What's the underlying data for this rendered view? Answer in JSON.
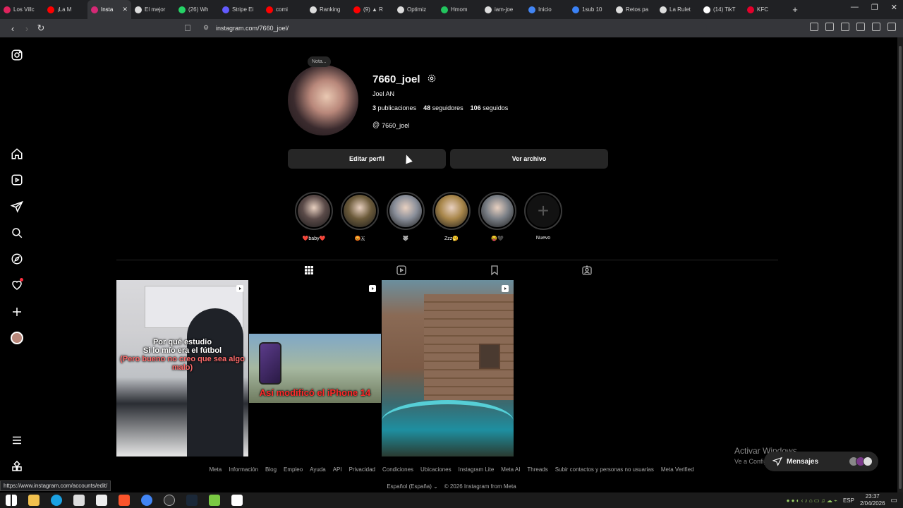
{
  "browser": {
    "tabs": [
      {
        "label": "Los Villc",
        "color": "#e0245e"
      },
      {
        "label": "¡La M",
        "color": "#ff0000"
      },
      {
        "label": "Insta",
        "color": "#d62976",
        "active": true
      },
      {
        "label": "El mejor",
        "color": "#dddddd"
      },
      {
        "label": "(26) Wh",
        "color": "#25d366"
      },
      {
        "label": "Stripe Ei",
        "color": "#635bff"
      },
      {
        "label": "comi",
        "color": "#ff0000"
      },
      {
        "label": "Ranking",
        "color": "#dddddd"
      },
      {
        "label": "(9) ▲ R",
        "color": "#ff0000"
      },
      {
        "label": "Optimiz",
        "color": "#dddddd"
      },
      {
        "label": "Hmom",
        "color": "#22c55e"
      },
      {
        "label": "iam-joe",
        "color": "#dddddd"
      },
      {
        "label": "Inicio",
        "color": "#4285f4"
      },
      {
        "label": "1sub 10",
        "color": "#3b82f6"
      },
      {
        "label": "Retos pa",
        "color": "#dddddd"
      },
      {
        "label": "La Rulet",
        "color": "#dddddd"
      },
      {
        "label": "(14) TikT",
        "color": "#ffffff"
      },
      {
        "label": "KFC",
        "color": "#e4002b"
      }
    ],
    "new_tab": "+",
    "url": "instagram.com/7660_joel/",
    "status_url": "https://www.instagram.com/accounts/edit/"
  },
  "sidebar": {
    "items": [
      {
        "name": "instagram-logo-icon"
      },
      {
        "name": "home-icon"
      },
      {
        "name": "reels-icon"
      },
      {
        "name": "messages-icon"
      },
      {
        "name": "search-icon"
      },
      {
        "name": "explore-icon"
      },
      {
        "name": "notifications-icon"
      },
      {
        "name": "create-icon"
      },
      {
        "name": "profile-icon"
      },
      {
        "name": "more-icon"
      },
      {
        "name": "also-from-meta-icon"
      }
    ]
  },
  "profile": {
    "note": "Nota...",
    "username": "7660_joel",
    "full_name": "Joel AN",
    "posts_count": "3",
    "posts_label": "publicaciones",
    "followers_count": "48",
    "followers_label": "seguidores",
    "following_count": "106",
    "following_label": "seguidos",
    "threads_handle": "7660_joel",
    "edit_button": "Editar perfil",
    "archive_button": "Ver archivo"
  },
  "highlights": [
    {
      "label": "❤️baby❤️",
      "color": "#5a4a48"
    },
    {
      "label": "😡🇦",
      "color": "#6b5a3a"
    },
    {
      "label": "🐺",
      "color": "#8a8f9a"
    },
    {
      "label": "Zzz🥱",
      "color": "#a8864a"
    },
    {
      "label": "😝🖤",
      "color": "#7a7f86"
    },
    {
      "label": "Nuevo",
      "new": true
    }
  ],
  "profile_tabs": [
    {
      "name": "posts-grid-icon",
      "active": true
    },
    {
      "name": "reels-tab-icon"
    },
    {
      "name": "saved-icon"
    },
    {
      "name": "tagged-icon"
    }
  ],
  "posts": [
    {
      "caption": "Por qué estudio\nSi lo mío era el fútbol\n(Pero bueno no creo que sea algo malo)",
      "reel": true
    },
    {
      "caption": "Así modificó el iPhone 14",
      "reel": true
    },
    {
      "caption": "",
      "reel": true
    }
  ],
  "footer": {
    "links": [
      "Meta",
      "Información",
      "Blog",
      "Empleo",
      "Ayuda",
      "API",
      "Privacidad",
      "Condiciones",
      "Ubicaciones",
      "Instagram Lite",
      "Meta AI",
      "Threads",
      "Subir contactos y personas no usuarias",
      "Meta Verified"
    ],
    "language": "Español (España)",
    "copyright": "© 2026 Instagram from Meta"
  },
  "messages_pill": {
    "label": "Mensajes"
  },
  "windows": {
    "watermark_title": "Activar Windows",
    "watermark_sub": "Ve a Configuración para activar Windows.",
    "lang": "ESP",
    "time": "23:37",
    "date": "2/04/2026"
  }
}
